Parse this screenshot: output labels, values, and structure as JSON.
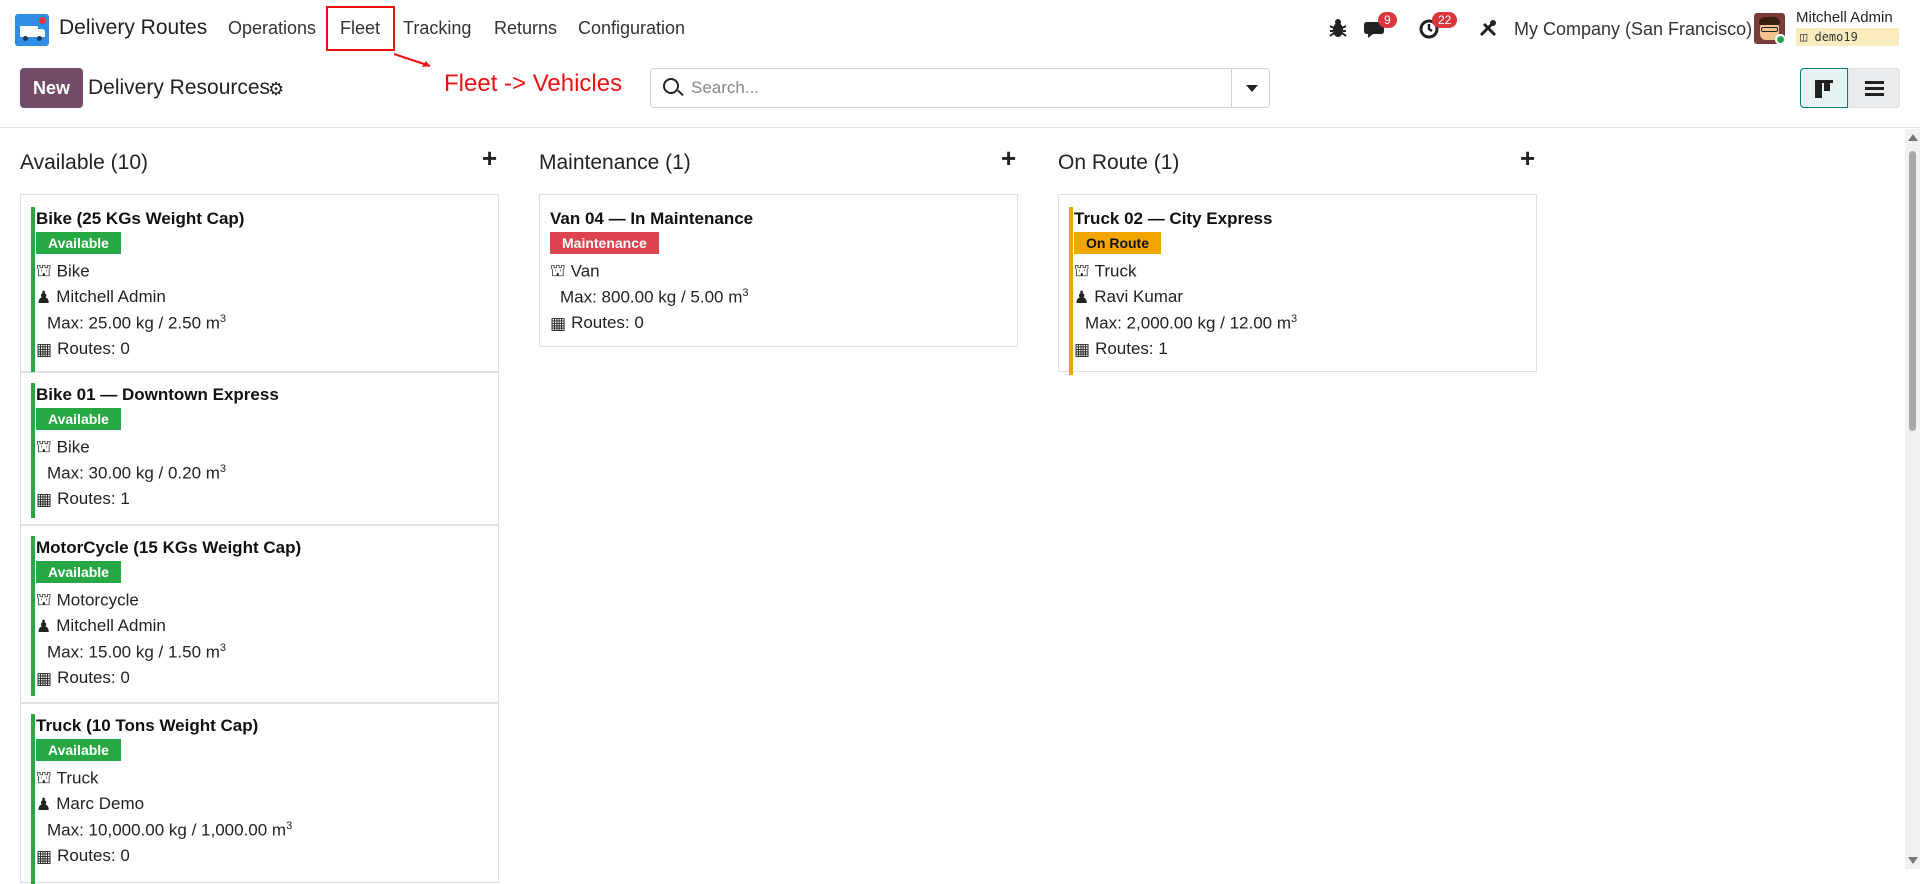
{
  "navbar": {
    "app_name": "Delivery Routes",
    "menu": [
      "Operations",
      "Fleet",
      "Tracking",
      "Returns",
      "Configuration"
    ],
    "messages_count": "9",
    "activities_count": "22",
    "company": "My Company (San Francisco)",
    "user_name": "Mitchell Admin",
    "database": "demo19"
  },
  "annotation": {
    "text": "Fleet -> Vehicles",
    "color": "#ee1111"
  },
  "control": {
    "new_label": "New",
    "title": "Delivery Resources",
    "search_placeholder": "Search...",
    "active_view": "kanban"
  },
  "columns": [
    {
      "title": "Available (10)",
      "cards": [
        {
          "name": "Bike (25 KGs Weight Cap)",
          "status": "Available",
          "type": "Bike",
          "driver": "Mitchell Admin",
          "capacity": "Max: 25.00 kg / 2.50 m",
          "routes": "Routes: 0"
        },
        {
          "name": "Bike 01 — Downtown Express",
          "status": "Available",
          "type": "Bike",
          "capacity": "Max: 30.00 kg / 0.20 m",
          "routes": "Routes: 1"
        },
        {
          "name": "MotorCycle (15 KGs Weight Cap)",
          "status": "Available",
          "type": "Motorcycle",
          "driver": "Mitchell Admin",
          "capacity": "Max: 15.00 kg / 1.50 m",
          "routes": "Routes: 0"
        },
        {
          "name": "Truck (10 Tons Weight Cap)",
          "status": "Available",
          "type": "Truck",
          "driver": "Marc Demo",
          "capacity": "Max: 10,000.00 kg / 1,000.00 m",
          "routes": "Routes: 0"
        }
      ]
    },
    {
      "title": "Maintenance (1)",
      "cards": [
        {
          "name": "Van 04 — In Maintenance",
          "status": "Maintenance",
          "type": "Van",
          "capacity": "Max: 800.00 kg / 5.00 m",
          "routes": "Routes: 0"
        }
      ]
    },
    {
      "title": "On Route (1)",
      "cards": [
        {
          "name": "Truck 02 — City Express",
          "status": "On Route",
          "type": "Truck",
          "driver": "Ravi Kumar",
          "capacity": "Max: 2,000.00 kg / 12.00 m",
          "routes": "Routes: 1"
        }
      ]
    }
  ],
  "superscript": "3",
  "colors": {
    "available": "#28a745",
    "maintenance": "#dc4450",
    "on_route": "#f0a500",
    "primary": "#714b67"
  }
}
